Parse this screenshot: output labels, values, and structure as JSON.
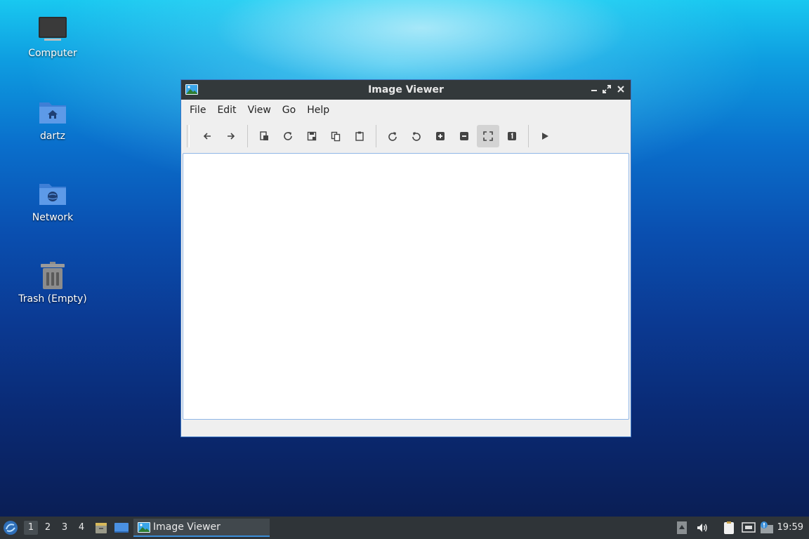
{
  "desktop": {
    "icons": [
      {
        "label": "Computer"
      },
      {
        "label": "dartz"
      },
      {
        "label": "Network"
      },
      {
        "label": "Trash (Empty)"
      }
    ]
  },
  "window": {
    "title": "Image Viewer",
    "controls": [
      "minimize-icon",
      "maximize-icon",
      "close-icon"
    ],
    "menu": [
      {
        "label": "File"
      },
      {
        "label": "Edit"
      },
      {
        "label": "View"
      },
      {
        "label": "Go"
      },
      {
        "label": "Help"
      }
    ],
    "toolbar": [
      "back-arrow-icon",
      "forward-arrow-icon",
      "open-file-icon",
      "reload-icon",
      "save-icon",
      "copy-icon",
      "paste-icon",
      "rotate-clockwise-icon",
      "rotate-counterclockwise-icon",
      "zoom-in-icon",
      "zoom-out-icon",
      "fit-to-window-icon",
      "original-size-icon",
      "slideshow-play-icon"
    ],
    "active_tool": "fit-to-window-icon"
  },
  "taskbar": {
    "workspaces": [
      "1",
      "2",
      "3",
      "4"
    ],
    "active_workspace": "1",
    "task_label": "Image Viewer",
    "clock": "19:59"
  },
  "colors": {
    "titlebar": "#33393b",
    "accent": "#3b8ed8",
    "taskbar": "#2f3438"
  }
}
